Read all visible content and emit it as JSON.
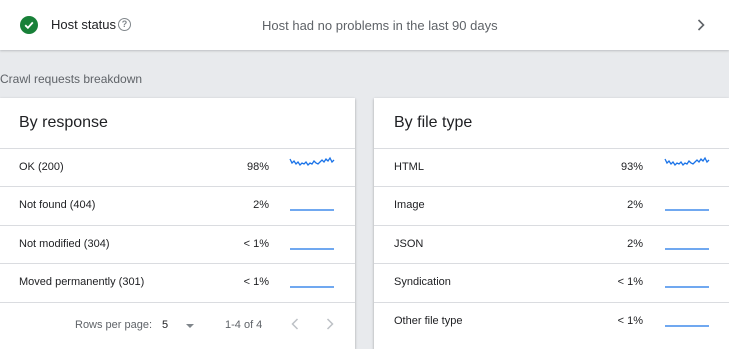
{
  "host_status": {
    "title": "Host status",
    "message": "Host had no problems in the last 90 days",
    "status_color": "#188038"
  },
  "section_label": "Crawl requests breakdown",
  "by_response": {
    "title": "By response",
    "rows": [
      {
        "label": "OK (200)",
        "percent": "98%",
        "trend": "active"
      },
      {
        "label": "Not found (404)",
        "percent": "2%",
        "trend": "flat"
      },
      {
        "label": "Not modified (304)",
        "percent": "< 1%",
        "trend": "flat"
      },
      {
        "label": "Moved permanently (301)",
        "percent": "< 1%",
        "trend": "flat"
      }
    ],
    "pagination": {
      "rows_per_page_label": "Rows per page:",
      "rows_per_page_value": "5",
      "range": "1-4 of 4"
    }
  },
  "by_file_type": {
    "title": "By file type",
    "rows": [
      {
        "label": "HTML",
        "percent": "93%",
        "trend": "active"
      },
      {
        "label": "Image",
        "percent": "2%",
        "trend": "flat"
      },
      {
        "label": "JSON",
        "percent": "2%",
        "trend": "flat"
      },
      {
        "label": "Syndication",
        "percent": "< 1%",
        "trend": "flat"
      },
      {
        "label": "Other file type",
        "percent": "< 1%",
        "trend": "flat"
      }
    ]
  },
  "colors": {
    "accent": "#1a73e8",
    "success": "#188038"
  }
}
